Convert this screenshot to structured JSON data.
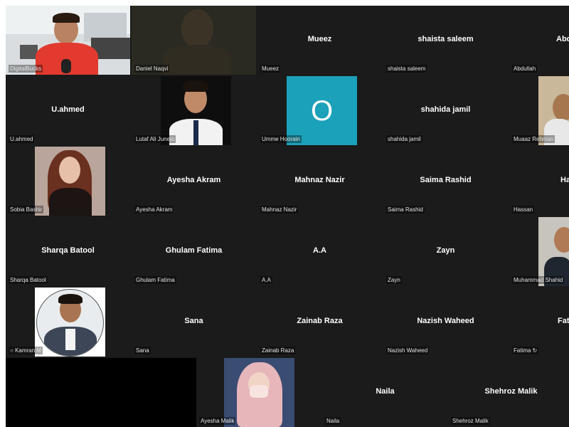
{
  "participants": [
    {
      "name": "DigitalBucks",
      "center": ""
    },
    {
      "name": "Daniel Naqvi",
      "center": ""
    },
    {
      "name": "Mueez",
      "center": "Mueez"
    },
    {
      "name": "shaista saleem",
      "center": "shaista saleem"
    },
    {
      "name": "Abdullah",
      "center": "Abd"
    },
    {
      "name": "U.ahmed",
      "center": "U.ahmed"
    },
    {
      "name": "Lutaf Ali Junejo",
      "center": ""
    },
    {
      "name": "Umme Hoorain",
      "center": "",
      "avatar_letter": "O",
      "avatar_color": "#1ba1b9"
    },
    {
      "name": "shahida jamil",
      "center": "shahida jamil"
    },
    {
      "name": "Muaaz Rehman",
      "center": ""
    },
    {
      "name": "Sobia Bashir",
      "center": ""
    },
    {
      "name": "Ayesha Akram",
      "center": "Ayesha Akram"
    },
    {
      "name": "Mahnaz Nazir",
      "center": "Mahnaz Nazir"
    },
    {
      "name": "Saima Rashid",
      "center": "Saima Rashid"
    },
    {
      "name": "Hassan",
      "center": "Ha"
    },
    {
      "name": "Sharqa Batool",
      "center": "Sharqa Batool"
    },
    {
      "name": "Ghulam Fatima",
      "center": "Ghulam Fatima"
    },
    {
      "name": "A.A",
      "center": "A.A"
    },
    {
      "name": "Zayn",
      "center": "Zayn"
    },
    {
      "name": "Muhammad Shahid",
      "center": ""
    },
    {
      "name": "Kamran M",
      "center": ""
    },
    {
      "name": "Sana",
      "center": "Sana"
    },
    {
      "name": "Zainab Raza",
      "center": "Zainab Raza"
    },
    {
      "name": "Nazish Waheed",
      "center": "Nazish Waheed"
    },
    {
      "name": "Fatima",
      "center": "Fat"
    },
    {
      "name": "Ayesha Malik",
      "center": ""
    },
    {
      "name": "Naila",
      "center": "Naila"
    },
    {
      "name": "Shehroz Malik",
      "center": "Shehroz Malik"
    }
  ],
  "theme": {
    "tile_bg": "#1b1b1b",
    "gallery_bg": "#1a1a1a",
    "label_color": "#e4e4e4"
  }
}
